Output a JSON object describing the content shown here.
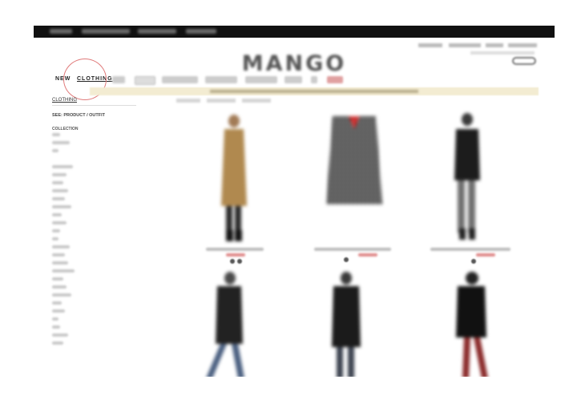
{
  "brand": {
    "logo_text": "MANGO"
  },
  "nav": {
    "new": "NEW",
    "clothing": "CLOTHING"
  },
  "sidebar": {
    "title": "CLOTHING",
    "see": "SEE: PRODUCT / OUTFIT",
    "collection": "COLLECTION"
  },
  "colors": {
    "highlight_circle": "#e07a7a",
    "banner": "#f3ecd2",
    "topbar": "#111111",
    "price": "#d33333"
  },
  "products": [
    {
      "name": "camel coat"
    },
    {
      "name": "houndstooth coat"
    },
    {
      "name": "black fur-collar coat"
    },
    {
      "name": "black puffer"
    },
    {
      "name": "black parka"
    },
    {
      "name": "black fur-hood jacket"
    }
  ]
}
